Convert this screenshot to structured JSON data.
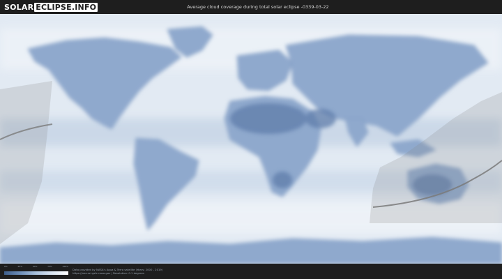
{
  "header": {
    "logo_part1": "SOLAR",
    "logo_part2": "ECLIPSE.INFO",
    "title": "Average cloud coverage during total solar eclipse -0339-03-22"
  },
  "legend": {
    "ticks": [
      "0%",
      "25%",
      "50%",
      "75%",
      "100%"
    ],
    "colors": [
      "#3e5f8c",
      "#6d8eb8",
      "#a9c1dc",
      "#dbe6f2",
      "#ffffff"
    ]
  },
  "credits": {
    "line1": "Data provided by NASA's Aqua & Terra satellite (Years: 2000 - 2019)",
    "line2": "https://neo.sci.gsfc.nasa.gov | Resolution: 0.1 degrees"
  },
  "map": {
    "ocean_color": "#dfe8f2",
    "land_cloud_color": "#7f9cc4",
    "clear_desert_color": "#5b79a6",
    "eclipse_shadow_color": "#6e6e6e"
  }
}
